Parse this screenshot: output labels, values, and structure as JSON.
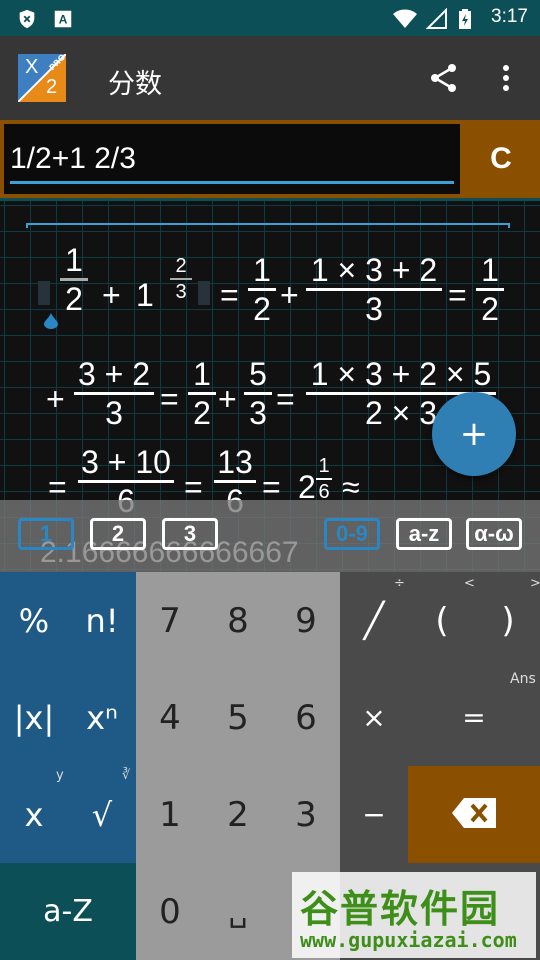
{
  "status_bar": {
    "time": "3:17"
  },
  "app_bar": {
    "title": "分数",
    "logo_x": "X",
    "logo_2": "2",
    "logo_pro": "PRO"
  },
  "input": {
    "expression": "1/2+1 2/3",
    "clear_label": "C"
  },
  "result": {
    "line1": {
      "f1n": "1",
      "f1d": "2",
      "plus": "+",
      "whole": "1",
      "f2n": "2",
      "f2d": "3",
      "eq1": "=",
      "f3n": "1",
      "f3d": "2",
      "plus2": "+",
      "f4n": "1 × 3 + 2",
      "f4d": "3",
      "eq2": "=",
      "f5n": "1",
      "f5d": "2"
    },
    "line2": {
      "plus": "+",
      "f1n": "3 + 2",
      "f1d": "3",
      "eq1": "=",
      "f2n": "1",
      "f2d": "2",
      "plus2": "+",
      "f3n": "5",
      "f3d": "3",
      "eq2": "=",
      "f4n": "1 × 3 + 2 × 5",
      "f4d": "2 × 3"
    },
    "line3": {
      "eq1": "=",
      "f1n": "3 + 10",
      "f1d": "6",
      "eq2": "=",
      "f2n": "13",
      "f2d": "6",
      "eq3": "=",
      "mixed_whole": "2",
      "mixed_n": "1",
      "mixed_d": "6",
      "approx": "≈"
    },
    "decimal": "2.16666666666667"
  },
  "fab": {
    "label": "+"
  },
  "tabs": [
    {
      "label": "1",
      "active": true
    },
    {
      "label": "2",
      "active": false
    },
    {
      "label": "3",
      "active": false
    },
    {
      "label": "0-9",
      "active": true
    },
    {
      "label": "a-z",
      "active": false
    },
    {
      "label": "α-ω",
      "active": false
    }
  ],
  "keys": {
    "percent": "%",
    "factorial": "n!",
    "abs": "|x|",
    "power": "xⁿ",
    "x": "x",
    "sqrt": "√",
    "sqrt_hint_y": "y",
    "sqrt_hint_root": "∛",
    "az": "a-Z",
    "d7": "7",
    "d8": "8",
    "d9": "9",
    "d4": "4",
    "d5": "5",
    "d6": "6",
    "d1": "1",
    "d2": "2",
    "d3": "3",
    "d0": "0",
    "space": "␣",
    "fraction": "╱",
    "fraction_hint": "÷",
    "lparen": "(",
    "lparen_hint": "<",
    "rparen": ")",
    "rparen_hint": ">",
    "ans_hint": "Ans",
    "multiply": "×",
    "equals": "=",
    "minus": "−"
  },
  "watermark": {
    "cn": "谷普软件园",
    "url": "www.gupuxiazai.com"
  },
  "colors": {
    "accent_blue": "#2a87c6",
    "brand_orange": "#8b4f00",
    "teal": "#0d4f56",
    "key_blue": "#1f5a86"
  }
}
